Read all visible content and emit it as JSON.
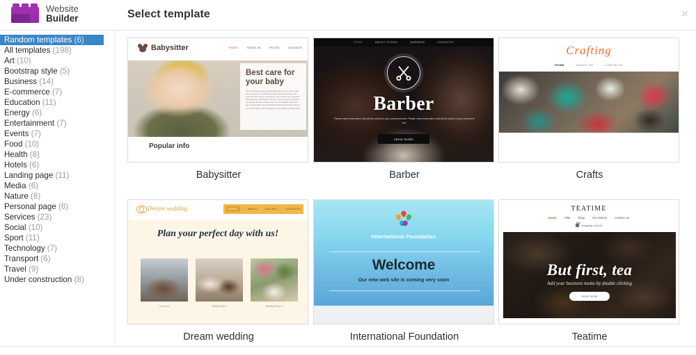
{
  "header": {
    "brand_line1": "Website",
    "brand_line2": "Builder",
    "title": "Select template",
    "close_label": "×",
    "brand_color": "#a22eb2",
    "brand_color_dark": "#7d2593"
  },
  "sidebar": {
    "active_color": "#3a86c8",
    "items": [
      {
        "label": "Random templates",
        "count": "(6)",
        "active": true
      },
      {
        "label": "All templates",
        "count": "(198)",
        "active": false
      },
      {
        "label": "Art",
        "count": "(10)",
        "active": false
      },
      {
        "label": "Bootstrap style",
        "count": "(5)",
        "active": false
      },
      {
        "label": "Business",
        "count": "(14)",
        "active": false
      },
      {
        "label": "E-commerce",
        "count": "(7)",
        "active": false
      },
      {
        "label": "Education",
        "count": "(11)",
        "active": false
      },
      {
        "label": "Energy",
        "count": "(6)",
        "active": false
      },
      {
        "label": "Entertainment",
        "count": "(7)",
        "active": false
      },
      {
        "label": "Events",
        "count": "(7)",
        "active": false
      },
      {
        "label": "Food",
        "count": "(10)",
        "active": false
      },
      {
        "label": "Health",
        "count": "(8)",
        "active": false
      },
      {
        "label": "Hotels",
        "count": "(6)",
        "active": false
      },
      {
        "label": "Landing page",
        "count": "(11)",
        "active": false
      },
      {
        "label": "Media",
        "count": "(6)",
        "active": false
      },
      {
        "label": "Nature",
        "count": "(8)",
        "active": false
      },
      {
        "label": "Personal page",
        "count": "(8)",
        "active": false
      },
      {
        "label": "Services",
        "count": "(23)",
        "active": false
      },
      {
        "label": "Social",
        "count": "(10)",
        "active": false
      },
      {
        "label": "Sport",
        "count": "(11)",
        "active": false
      },
      {
        "label": "Technology",
        "count": "(7)",
        "active": false
      },
      {
        "label": "Transport",
        "count": "(6)",
        "active": false
      },
      {
        "label": "Travel",
        "count": "(9)",
        "active": false
      },
      {
        "label": "Under construction",
        "count": "(8)",
        "active": false
      }
    ]
  },
  "templates": {
    "babysitter": {
      "caption": "Babysitter",
      "site_name": "Babysitter",
      "nav": [
        "Home",
        "About as",
        "Prices",
        "Contacts"
      ],
      "heading": "Best care for your baby",
      "body": "You will find the latest information about us on this page. Our company is constantly evolving and growing. We provide wide range of services. Our mission is to provide best solution that helps everyone. If you want to contact us, please fill the contact form on our website. We wish you a good day! You will find the latest information about us on this page. Our company is constantly evolving and.",
      "footer_heading": "Popular info"
    },
    "barber": {
      "caption": "Barber",
      "nav": [
        "HOME",
        "ABOUT STUDIO",
        "BARBERS",
        "CONTACTS"
      ],
      "title": "Barber",
      "subtitle": "Please insert information that will be useful for your customers here. Please insert information that will be useful to your customers too!",
      "button": "About studio"
    },
    "crafts": {
      "caption": "Crafts",
      "site_name": "Crafting",
      "nav": [
        "HOME",
        "ABOUT US",
        "CONTACTS"
      ]
    },
    "dream_wedding": {
      "caption": "Dream wedding",
      "site_name": "Dream wedding",
      "nav": [
        "HOME",
        "ABOUT",
        "GALLERY",
        "CONTACTS"
      ],
      "heading": "Plan your perfect day with us!",
      "thumbs": [
        {
          "label": "Ceremony"
        },
        {
          "label": "Wedding Dress"
        },
        {
          "label": "Wedding Flowers"
        }
      ]
    },
    "international_foundation": {
      "caption": "International Foundation",
      "org_name": "International Foundation",
      "heading": "Welcome",
      "subtitle": "Our new web site is coming very soon",
      "logo_colors": [
        "#e8432f",
        "#f0a02a",
        "#3dbb52",
        "#2aa7dd",
        "#8e44ad"
      ]
    },
    "teatime": {
      "caption": "Teatime",
      "site_name": "TEATIME",
      "nav": [
        "Home",
        "Gifts",
        "Shop",
        "Our History",
        "Contact Us"
      ],
      "cart": "Shopping Cart (0)",
      "heading": "But first, tea",
      "subtitle": "Add your business motto by double clicking",
      "button": "SHOP NOW"
    }
  }
}
